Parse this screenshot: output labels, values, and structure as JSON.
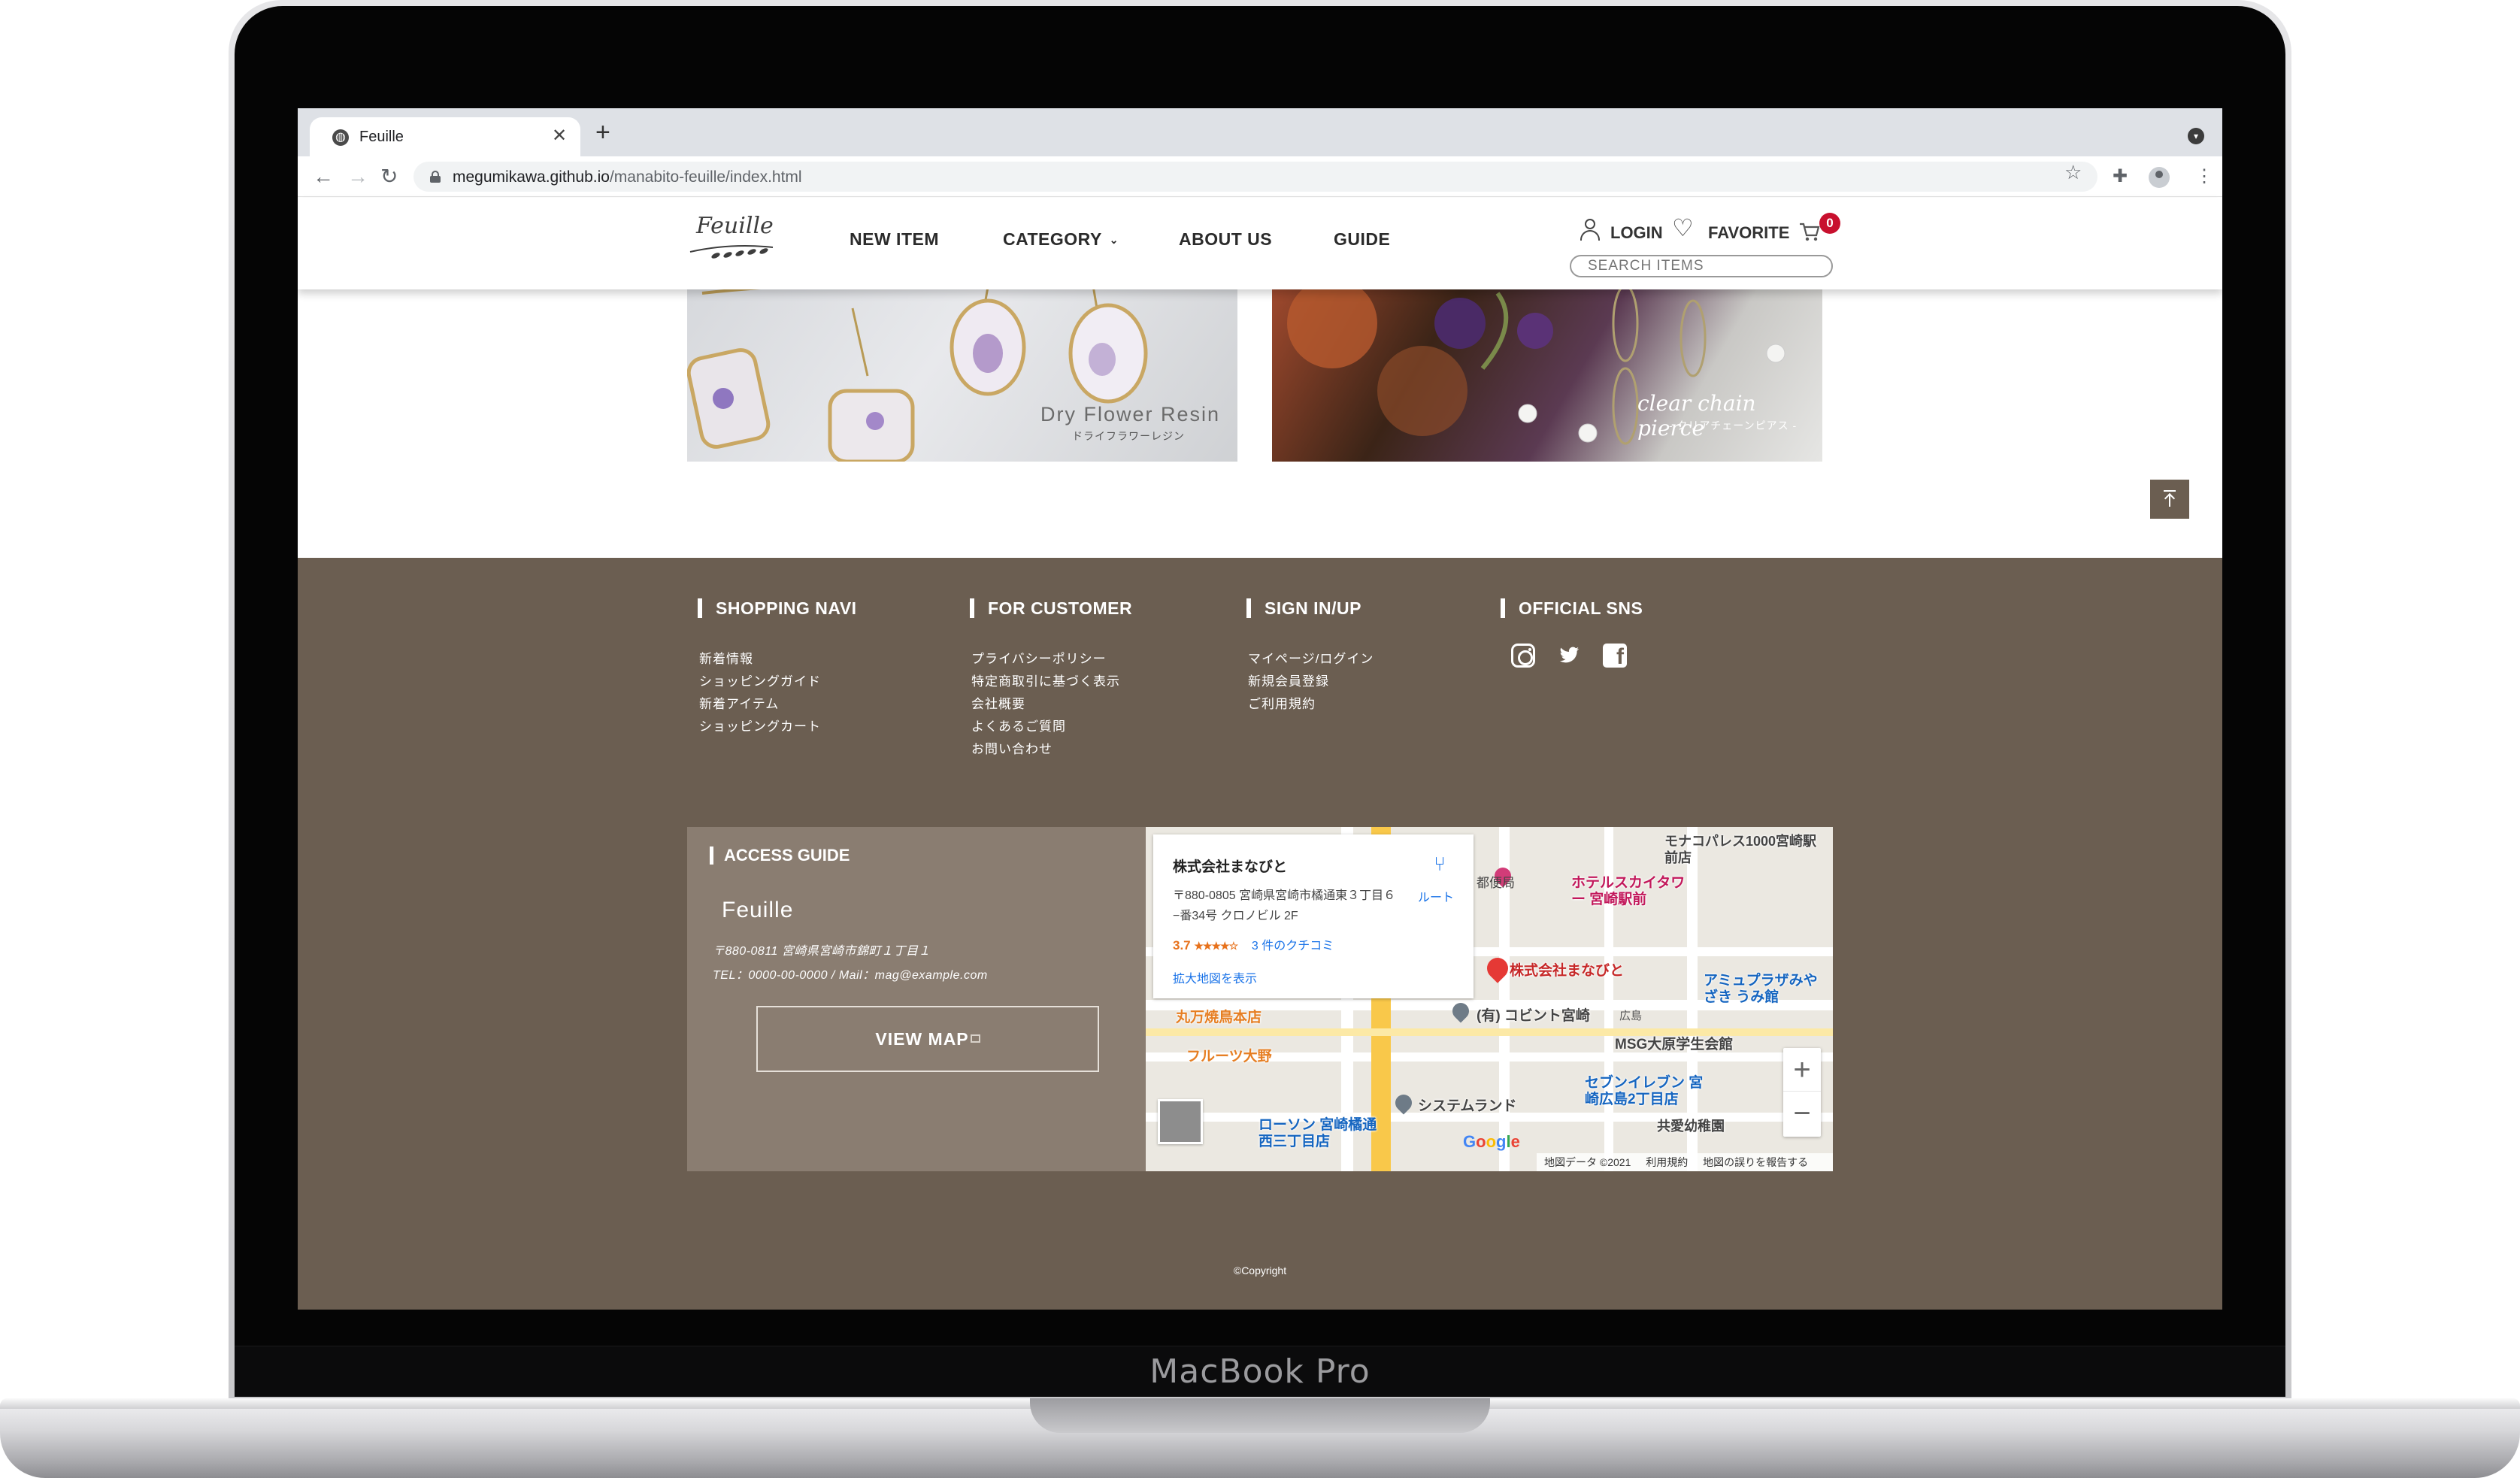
{
  "device": {
    "brand": "MacBook Pro"
  },
  "browser": {
    "tab_title": "Feuille",
    "new_tab": "+",
    "tab_close": "✕",
    "url_host": "megumikawa.github.io",
    "url_path": "/manabito-feuille/index.html"
  },
  "header": {
    "logo": "Feuille",
    "nav": [
      "NEW ITEM",
      "CATEGORY",
      "ABOUT US",
      "GUIDE"
    ],
    "login": "LOGIN",
    "favorite": "FAVORITE",
    "cart_count": "0",
    "search_placeholder": "SEARCH ITEMS"
  },
  "banners": [
    {
      "en": "Dry Flower Resin",
      "jp": "ドライフラワーレジン"
    },
    {
      "script": "clear chain pierce",
      "jp": "- クリアチェーンピアス -"
    }
  ],
  "footer": {
    "columns": [
      {
        "title": "SHOPPING NAVI",
        "items": [
          "新着情報",
          "ショッピングガイド",
          "新着アイテム",
          "ショッピングカート"
        ]
      },
      {
        "title": "FOR CUSTOMER",
        "items": [
          "プライバシーポリシー",
          "特定商取引に基づく表示",
          "会社概要",
          "よくあるご質問",
          "お問い合わせ"
        ]
      },
      {
        "title": "SIGN IN/UP",
        "items": [
          "マイページ/ログイン",
          "新規会員登録",
          "ご利用規約"
        ]
      },
      {
        "title": "OFFICIAL SNS",
        "items": []
      }
    ],
    "sns_icons": [
      "instagram-icon",
      "twitter-icon",
      "facebook-icon"
    ],
    "access": {
      "title": "ACCESS GUIDE",
      "name": "Feuille",
      "address": "〒880-0811 宮崎県宮崎市錦町１丁目１",
      "contact": "TEL：0000-00-0000 / Mail：mag@example.com",
      "button": "VIEW MAP"
    },
    "map": {
      "place": "株式会社まなびと",
      "address": "〒880-0805 宮崎県宮崎市橘通東３丁目６−番34号 クロノビル 2F",
      "rating": "3.7",
      "stars": "★★★★☆",
      "reviews": "3 件のクチコミ",
      "route": "ルート",
      "enlarge": "拡大地図を表示",
      "pin_label": "株式会社まなびと",
      "labels": [
        "ホテルスカイタワー 宮崎駅前",
        "(有) コビント宮崎",
        "丸万焼鳥本店",
        "フルーツ大野",
        "システムランド",
        "ローソン 宮崎橘通西三丁目店",
        "セブンイレブン 宮崎広島2丁目店",
        "アミュプラザみやざき うみ館",
        "MSG大原学生会館",
        "モナコパレス1000宮崎駅前店",
        "共愛幼稚園",
        "広島",
        "都便局"
      ],
      "footer": [
        "地図データ ©2021",
        "利用規約",
        "地図の誤りを報告する"
      ],
      "google": "Google"
    },
    "copyright": "©Copyright"
  }
}
